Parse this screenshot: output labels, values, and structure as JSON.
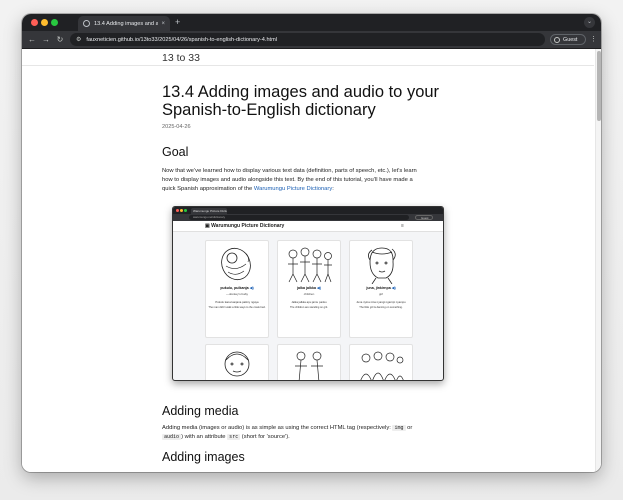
{
  "browser": {
    "tab_title": "13.4 Adding images and aud",
    "tab_close": "×",
    "new_tab": "+",
    "tab_search": "⌄",
    "back": "←",
    "forward": "→",
    "reload": "↻",
    "tune": "⚙",
    "url": "fauxneticien.github.io/13to33/2025/04/26/spanish-to-english-dictionary-4.html",
    "profile": "Guest",
    "menu": "⋮"
  },
  "site": {
    "title": "13 to 33"
  },
  "post": {
    "title_line1": "13.4 Adding images and audio to your",
    "title_line2": "Spanish-to-English dictionary",
    "date": "2025-04-26"
  },
  "goal": {
    "heading": "Goal",
    "line1": "Now that we’ve learned how to display various text data (definition, parts of speech, etc.), let’s learn",
    "line2": "how to display images and audio alongside this text. By the end of this tutorial, you’ll have made a",
    "line3_before": "quick Spanish approximation of the ",
    "line3_link": "Warumungu Picture Dictionary",
    "line3_after": ":"
  },
  "screenshot": {
    "tab_title": "Warumungu Picture Dictionary",
    "url": "warumungu.net/dictionary",
    "guest": "Guest",
    "app_title": "Warumungu Picture Dictionary",
    "menu": "≡",
    "cards": [
      {
        "word": "pukulu, pulkanja",
        "audio": "◀)",
        "gloss": "—donkey's baby",
        "ex": "Pukulu kana kanjana pakiny ngaya",
        "ex_tr": "The man didn't walk a little ways to the creek bed.",
        "scene": "baby"
      },
      {
        "word": "jalka jalkka",
        "audio": "◀)",
        "gloss": "children",
        "ex": "Jalka jalkka apu jarnu panku",
        "ex_tr": "The children are standing on grit.",
        "scene": "group"
      },
      {
        "word": "juna, jinkirnpa",
        "audio": "◀)",
        "gloss": "girl",
        "ex": "Juna nyina nina nyangi ngarnpi nyampu",
        "ex_tr": "The little girl is dancing on something.",
        "scene": "girl"
      }
    ]
  },
  "media": {
    "heading": "Adding media",
    "line1_before": "Adding media (images or audio) is as simple as using the correct HTML tag (respectively: ",
    "code_img": "img",
    "line1_or": " or",
    "code_audio": "audio",
    "line2_mid": ") with an attribute ",
    "code_src": "src",
    "line2_after": " (short for 'source').",
    "images_heading": "Adding images"
  },
  "colors": {
    "link": "#1a5fb4",
    "chrome_dark": "#202124",
    "chrome_toolbar": "#35363a"
  }
}
